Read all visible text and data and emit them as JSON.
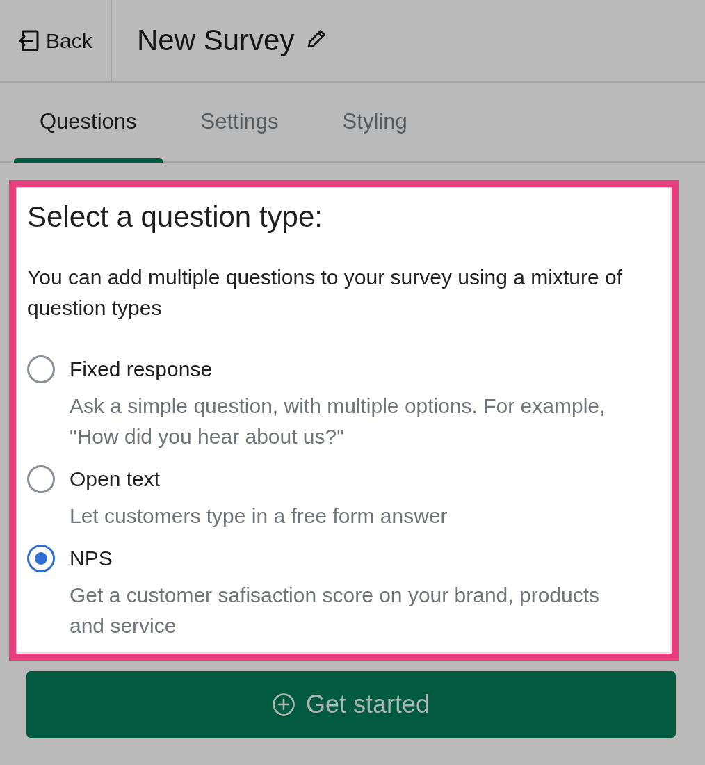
{
  "header": {
    "back_label": "Back",
    "title": "New Survey"
  },
  "tabs": [
    {
      "label": "Questions",
      "selected": true
    },
    {
      "label": "Settings",
      "selected": false
    },
    {
      "label": "Styling",
      "selected": false
    }
  ],
  "panel": {
    "title": "Select a question type:",
    "description": "You can add multiple questions to your survey using a mixture of question types"
  },
  "options": [
    {
      "label": "Fixed response",
      "description": "Ask a simple question, with multiple options. For example, \"How did you hear about us?\"",
      "selected": false
    },
    {
      "label": "Open text",
      "description": "Let customers type in a free form answer",
      "selected": false
    },
    {
      "label": "NPS",
      "description": "Get a customer safisaction score on your brand, products and service",
      "selected": true
    }
  ],
  "button": {
    "label": "Get started"
  }
}
